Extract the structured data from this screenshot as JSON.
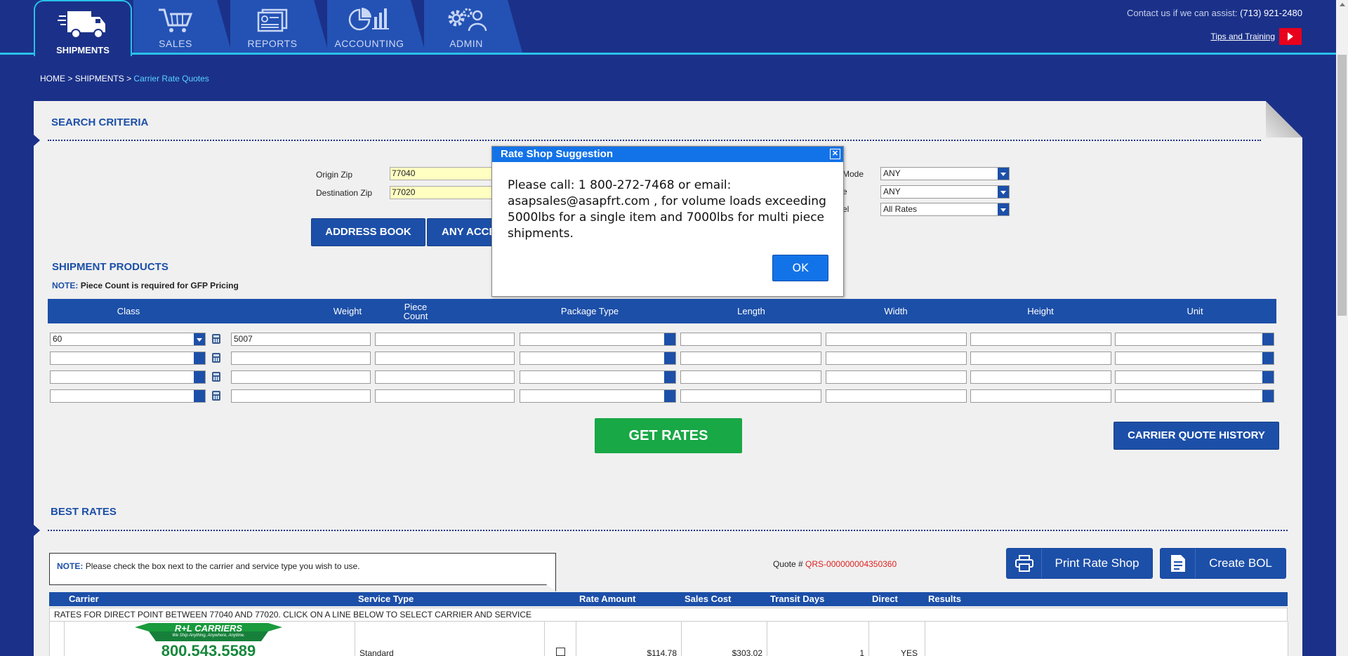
{
  "nav": {
    "tabs": [
      {
        "label": "SHIPMENTS",
        "icon": "truck-icon",
        "active": true
      },
      {
        "label": "SALES",
        "icon": "cart-icon"
      },
      {
        "label": "REPORTS",
        "icon": "reports-icon"
      },
      {
        "label": "ACCOUNTING",
        "icon": "chart-icon"
      },
      {
        "label": "ADMIN",
        "icon": "admin-icon"
      }
    ],
    "contact_label": "Contact us if we can assist:",
    "contact_phone": "(713) 921-2480",
    "tips_label": "Tips and Training"
  },
  "breadcrumb": {
    "home": "HOME",
    "sep1": ">",
    "shipments": "SHIPMENTS",
    "sep2": ">",
    "current": "Carrier Rate Quotes"
  },
  "search": {
    "title": "SEARCH CRITERIA",
    "origin_label": "Origin Zip",
    "origin_value": "77040",
    "dest_label": "Destination Zip",
    "dest_value": "77020",
    "mode_label": "Mode",
    "mode_value": "ANY",
    "type_label": "e",
    "type_value": "ANY",
    "level_label": "el",
    "level_value": "All Rates",
    "address_book": "ADDRESS BOOK",
    "any_acc": "ANY ACCE"
  },
  "products": {
    "title": "SHIPMENT PRODUCTS",
    "note_label": "NOTE:",
    "note_text": "Piece Count is required for GFP Pricing",
    "columns": {
      "class": "Class",
      "weight": "Weight",
      "piece": "Piece",
      "count": "Count",
      "package": "Package Type",
      "length": "Length",
      "width": "Width",
      "height": "Height",
      "unit": "Unit"
    },
    "rows": [
      {
        "class": "60",
        "weight": "5007"
      },
      {
        "class": "",
        "weight": ""
      },
      {
        "class": "",
        "weight": ""
      },
      {
        "class": "",
        "weight": ""
      }
    ],
    "get_rates": "GET RATES",
    "history": "CARRIER QUOTE HISTORY"
  },
  "best": {
    "title": "BEST RATES",
    "note_label": "NOTE:",
    "note_text": "Please check the box next to the carrier and service type you wish to use.",
    "quote_label": "Quote #",
    "quote_number": "QRS-000000004350360",
    "print": "Print Rate Shop",
    "create_bol": "Create BOL",
    "columns": {
      "carrier": "Carrier",
      "service": "Service Type",
      "rate": "Rate Amount",
      "sales": "Sales Cost",
      "transit": "Transit Days",
      "direct": "Direct",
      "results": "Results"
    },
    "subheader": "RATES FOR DIRECT POINT BETWEEN 77040 AND 77020. CLICK ON A LINE BELOW TO SELECT CARRIER AND SERVICE",
    "row": {
      "logo_text": "R+L CARRIERS",
      "logo_tagline": "We Ship Anything, Anywhere, Anytime.",
      "logo_phone": "800.543.5589",
      "service": "Standard",
      "rate": "$114.78",
      "sales": "$303.02",
      "transit": "1",
      "direct": "YES"
    }
  },
  "modal": {
    "title": "Rate Shop Suggestion",
    "message": "Please call: 1 800-272-7468 or email: asapsales@asapfrt.com , for volume loads exceeding 5000lbs for a single item and 7000lbs for multi piece shipments.",
    "ok": "OK"
  },
  "colors": {
    "navy": "#1b3189",
    "accent": "#29c0e8",
    "button_blue": "#1c4fa8",
    "green": "#19a846",
    "modal_blue": "#1273e8",
    "quote_red": "#e02020"
  }
}
